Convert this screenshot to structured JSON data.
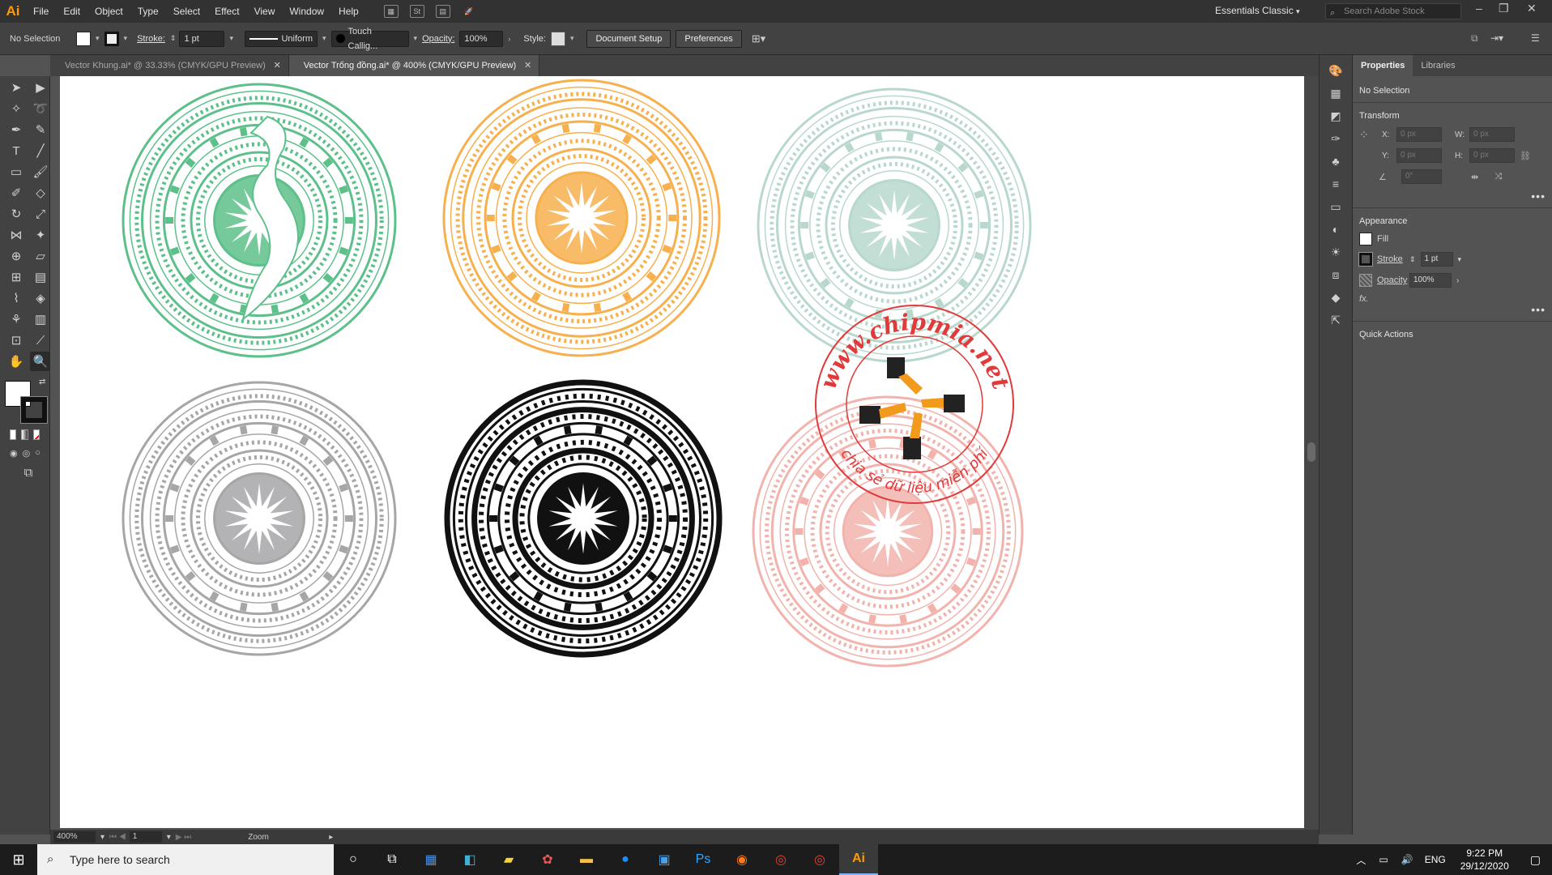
{
  "app": {
    "logo": "Ai"
  },
  "menu": [
    "File",
    "Edit",
    "Object",
    "Type",
    "Select",
    "Effect",
    "View",
    "Window",
    "Help"
  ],
  "menubar_icons": [
    "bridge-icon",
    "stock-icon",
    "arrange-icon",
    "gpu-icon"
  ],
  "workspace": "Essentials Classic",
  "search_stock_placeholder": "Search Adobe Stock",
  "control": {
    "selection": "No Selection",
    "stroke_label": "Stroke:",
    "stroke_value": "1 pt",
    "profile": "Uniform",
    "brush": "Touch Callig...",
    "opacity_label": "Opacity:",
    "opacity_value": "100%",
    "style_label": "Style:",
    "document_setup": "Document Setup",
    "preferences": "Preferences"
  },
  "tabs": [
    {
      "label": "Vector Khung.ai* @ 33.33% (CMYK/GPU Preview)",
      "active": false
    },
    {
      "label": "Vector Trống đồng.ai* @ 400% (CMYK/GPU Preview)",
      "active": true
    }
  ],
  "status": {
    "zoom": "400%",
    "artboard": "1",
    "tool": "Zoom"
  },
  "properties": {
    "tabs": [
      "Properties",
      "Libraries"
    ],
    "selection": "No Selection",
    "transform_title": "Transform",
    "x_label": "X:",
    "y_label": "Y:",
    "w_label": "W:",
    "h_label": "H:",
    "x": "0 px",
    "y": "0 px",
    "w": "0 px",
    "h": "0 px",
    "angle": "0°",
    "appearance_title": "Appearance",
    "fill_label": "Fill",
    "stroke_label": "Stroke",
    "stroke_value": "1 pt",
    "opacity_label": "Opacity",
    "opacity_value": "100%",
    "fx": "fx.",
    "quick_actions": "Quick Actions"
  },
  "artwork": {
    "drums": [
      {
        "name": "green-drum",
        "color": "#5dc08a"
      },
      {
        "name": "orange-drum",
        "color": "#f7b04e"
      },
      {
        "name": "mint-drum",
        "color": "#b8d8cc"
      },
      {
        "name": "gray-drum",
        "color": "#a6a6a8"
      },
      {
        "name": "black-drum",
        "color": "#111111"
      },
      {
        "name": "pink-drum",
        "color": "#f2b3ad"
      }
    ],
    "watermark": {
      "top_text": "www.chipmia.net",
      "bottom_text": "chia sẻ dữ liệu miễn phí",
      "color": "#e03a3a"
    }
  },
  "taskbar": {
    "search_placeholder": "Type here to search",
    "language": "ENG",
    "time": "9:22 PM",
    "date": "29/12/2020"
  }
}
